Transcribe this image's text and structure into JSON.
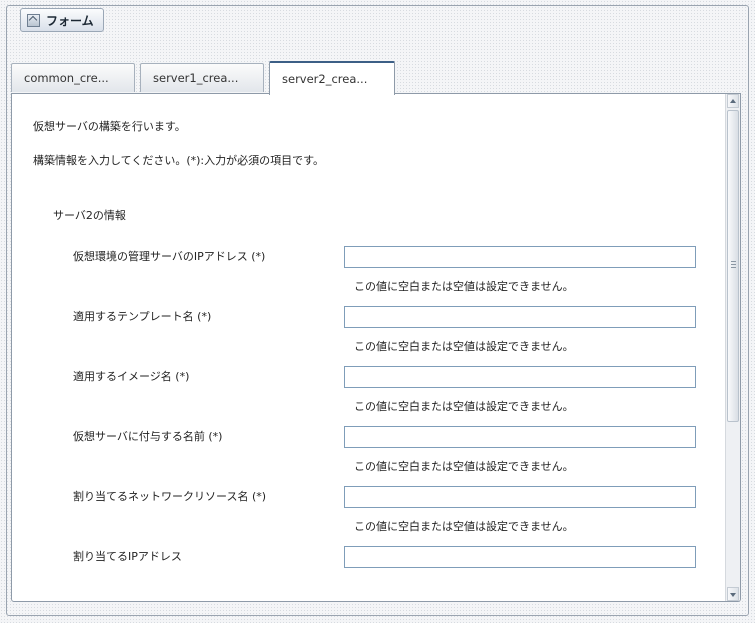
{
  "panel": {
    "title": "フォーム"
  },
  "tabs": [
    {
      "label": "common_cre..."
    },
    {
      "label": "server1_crea..."
    },
    {
      "label": "server2_crea..."
    }
  ],
  "form": {
    "intro": "仮想サーバの構築を行います。",
    "instruction": "構築情報を入力してください。(*):入力が必須の項目です。",
    "section_title": "サーバ2の情報",
    "fields": [
      {
        "label": "仮想環境の管理サーバのIPアドレス (*)",
        "value": "",
        "error": "この値に空白または空値は設定できません。"
      },
      {
        "label": "適用するテンプレート名 (*)",
        "value": "",
        "error": "この値に空白または空値は設定できません。"
      },
      {
        "label": "適用するイメージ名 (*)",
        "value": "",
        "error": "この値に空白または空値は設定できません。"
      },
      {
        "label": "仮想サーバに付与する名前 (*)",
        "value": "",
        "error": "この値に空白または空値は設定できません。"
      },
      {
        "label": "割り当てるネットワークリソース名 (*)",
        "value": "",
        "error": "この値に空白または空値は設定できません。"
      },
      {
        "label": "割り当てるIPアドレス",
        "value": ""
      }
    ]
  }
}
